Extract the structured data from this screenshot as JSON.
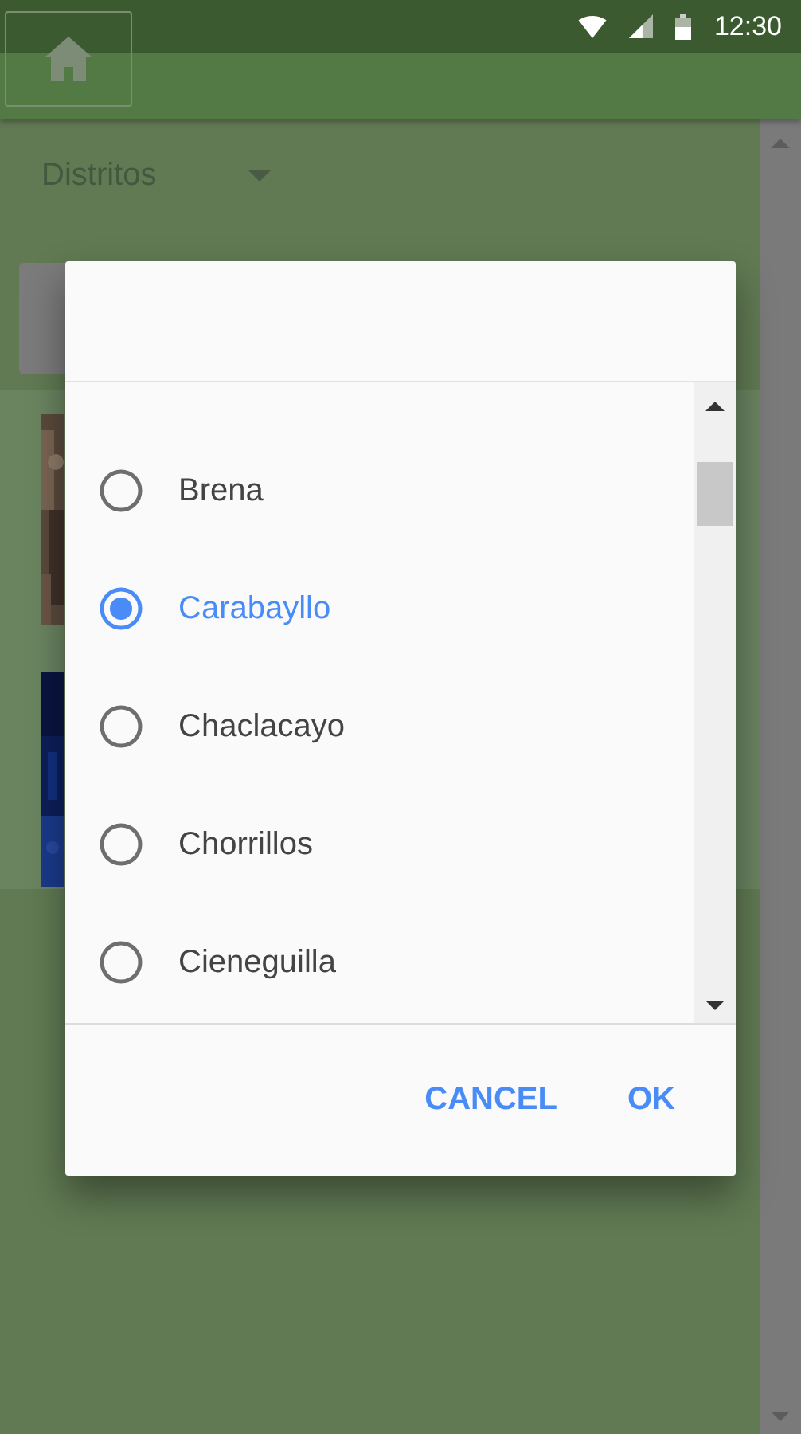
{
  "status_bar": {
    "time": "12:30"
  },
  "filter": {
    "label": "Distritos"
  },
  "dialog": {
    "options": [
      {
        "label": "Brena",
        "selected": false
      },
      {
        "label": "Carabayllo",
        "selected": true
      },
      {
        "label": "Chaclacayo",
        "selected": false
      },
      {
        "label": "Chorrillos",
        "selected": false
      },
      {
        "label": "Cieneguilla",
        "selected": false
      }
    ],
    "buttons": [
      {
        "label": "CANCEL"
      },
      {
        "label": "OK"
      }
    ]
  }
}
